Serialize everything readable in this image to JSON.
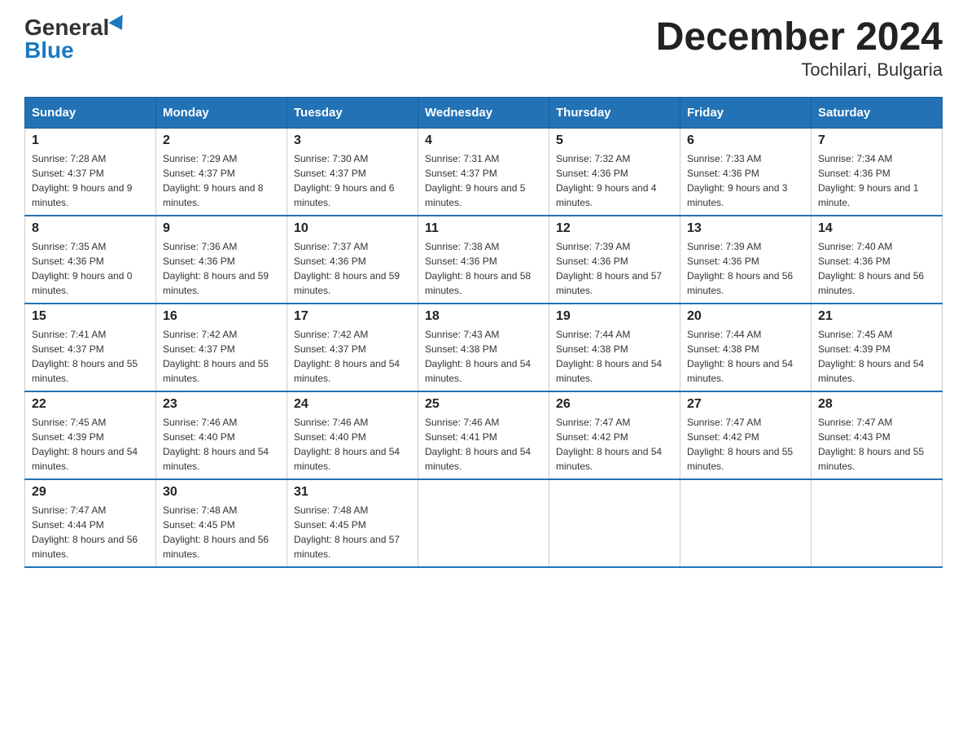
{
  "logo": {
    "general": "General",
    "blue": "Blue"
  },
  "title": "December 2024",
  "subtitle": "Tochilari, Bulgaria",
  "days_of_week": [
    "Sunday",
    "Monday",
    "Tuesday",
    "Wednesday",
    "Thursday",
    "Friday",
    "Saturday"
  ],
  "weeks": [
    [
      {
        "day": "1",
        "sunrise": "7:28 AM",
        "sunset": "4:37 PM",
        "daylight": "9 hours and 9 minutes."
      },
      {
        "day": "2",
        "sunrise": "7:29 AM",
        "sunset": "4:37 PM",
        "daylight": "9 hours and 8 minutes."
      },
      {
        "day": "3",
        "sunrise": "7:30 AM",
        "sunset": "4:37 PM",
        "daylight": "9 hours and 6 minutes."
      },
      {
        "day": "4",
        "sunrise": "7:31 AM",
        "sunset": "4:37 PM",
        "daylight": "9 hours and 5 minutes."
      },
      {
        "day": "5",
        "sunrise": "7:32 AM",
        "sunset": "4:36 PM",
        "daylight": "9 hours and 4 minutes."
      },
      {
        "day": "6",
        "sunrise": "7:33 AM",
        "sunset": "4:36 PM",
        "daylight": "9 hours and 3 minutes."
      },
      {
        "day": "7",
        "sunrise": "7:34 AM",
        "sunset": "4:36 PM",
        "daylight": "9 hours and 1 minute."
      }
    ],
    [
      {
        "day": "8",
        "sunrise": "7:35 AM",
        "sunset": "4:36 PM",
        "daylight": "9 hours and 0 minutes."
      },
      {
        "day": "9",
        "sunrise": "7:36 AM",
        "sunset": "4:36 PM",
        "daylight": "8 hours and 59 minutes."
      },
      {
        "day": "10",
        "sunrise": "7:37 AM",
        "sunset": "4:36 PM",
        "daylight": "8 hours and 59 minutes."
      },
      {
        "day": "11",
        "sunrise": "7:38 AM",
        "sunset": "4:36 PM",
        "daylight": "8 hours and 58 minutes."
      },
      {
        "day": "12",
        "sunrise": "7:39 AM",
        "sunset": "4:36 PM",
        "daylight": "8 hours and 57 minutes."
      },
      {
        "day": "13",
        "sunrise": "7:39 AM",
        "sunset": "4:36 PM",
        "daylight": "8 hours and 56 minutes."
      },
      {
        "day": "14",
        "sunrise": "7:40 AM",
        "sunset": "4:36 PM",
        "daylight": "8 hours and 56 minutes."
      }
    ],
    [
      {
        "day": "15",
        "sunrise": "7:41 AM",
        "sunset": "4:37 PM",
        "daylight": "8 hours and 55 minutes."
      },
      {
        "day": "16",
        "sunrise": "7:42 AM",
        "sunset": "4:37 PM",
        "daylight": "8 hours and 55 minutes."
      },
      {
        "day": "17",
        "sunrise": "7:42 AM",
        "sunset": "4:37 PM",
        "daylight": "8 hours and 54 minutes."
      },
      {
        "day": "18",
        "sunrise": "7:43 AM",
        "sunset": "4:38 PM",
        "daylight": "8 hours and 54 minutes."
      },
      {
        "day": "19",
        "sunrise": "7:44 AM",
        "sunset": "4:38 PM",
        "daylight": "8 hours and 54 minutes."
      },
      {
        "day": "20",
        "sunrise": "7:44 AM",
        "sunset": "4:38 PM",
        "daylight": "8 hours and 54 minutes."
      },
      {
        "day": "21",
        "sunrise": "7:45 AM",
        "sunset": "4:39 PM",
        "daylight": "8 hours and 54 minutes."
      }
    ],
    [
      {
        "day": "22",
        "sunrise": "7:45 AM",
        "sunset": "4:39 PM",
        "daylight": "8 hours and 54 minutes."
      },
      {
        "day": "23",
        "sunrise": "7:46 AM",
        "sunset": "4:40 PM",
        "daylight": "8 hours and 54 minutes."
      },
      {
        "day": "24",
        "sunrise": "7:46 AM",
        "sunset": "4:40 PM",
        "daylight": "8 hours and 54 minutes."
      },
      {
        "day": "25",
        "sunrise": "7:46 AM",
        "sunset": "4:41 PM",
        "daylight": "8 hours and 54 minutes."
      },
      {
        "day": "26",
        "sunrise": "7:47 AM",
        "sunset": "4:42 PM",
        "daylight": "8 hours and 54 minutes."
      },
      {
        "day": "27",
        "sunrise": "7:47 AM",
        "sunset": "4:42 PM",
        "daylight": "8 hours and 55 minutes."
      },
      {
        "day": "28",
        "sunrise": "7:47 AM",
        "sunset": "4:43 PM",
        "daylight": "8 hours and 55 minutes."
      }
    ],
    [
      {
        "day": "29",
        "sunrise": "7:47 AM",
        "sunset": "4:44 PM",
        "daylight": "8 hours and 56 minutes."
      },
      {
        "day": "30",
        "sunrise": "7:48 AM",
        "sunset": "4:45 PM",
        "daylight": "8 hours and 56 minutes."
      },
      {
        "day": "31",
        "sunrise": "7:48 AM",
        "sunset": "4:45 PM",
        "daylight": "8 hours and 57 minutes."
      },
      null,
      null,
      null,
      null
    ]
  ]
}
